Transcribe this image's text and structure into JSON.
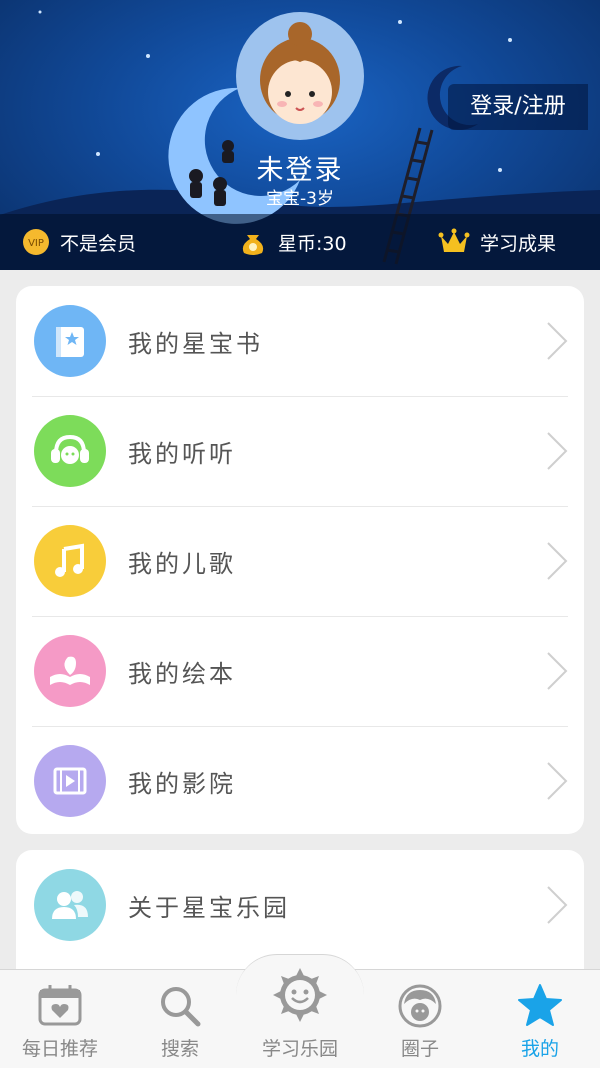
{
  "header": {
    "username": "未登录",
    "age": "宝宝-3岁",
    "login_label": "登录/注册"
  },
  "status_bar": {
    "vip_label": "不是会员",
    "coins_label": "星币:30",
    "achievement_label": "学习成果"
  },
  "menu": {
    "items": [
      {
        "label": "我的星宝书",
        "icon": "book-star-icon",
        "color": "#6fb6f5"
      },
      {
        "label": "我的听听",
        "icon": "headphones-icon",
        "color": "#7ddc5a"
      },
      {
        "label": "我的儿歌",
        "icon": "music-note-icon",
        "color": "#f8cd3a"
      },
      {
        "label": "我的绘本",
        "icon": "picture-book-icon",
        "color": "#f59ac6"
      },
      {
        "label": "我的影院",
        "icon": "film-play-icon",
        "color": "#b6a9ef"
      }
    ]
  },
  "about": {
    "label": "关于星宝乐园",
    "icon": "users-icon",
    "color": "#8fd8e4"
  },
  "tabbar": {
    "tabs": [
      {
        "label": "每日推荐",
        "icon": "calendar-heart-icon"
      },
      {
        "label": "搜索",
        "icon": "search-icon"
      },
      {
        "label": "学习乐园",
        "icon": "sun-smile-icon"
      },
      {
        "label": "圈子",
        "icon": "circle-face-icon"
      },
      {
        "label": "我的",
        "icon": "star-icon"
      }
    ],
    "active_color": "#1aa3e8"
  }
}
